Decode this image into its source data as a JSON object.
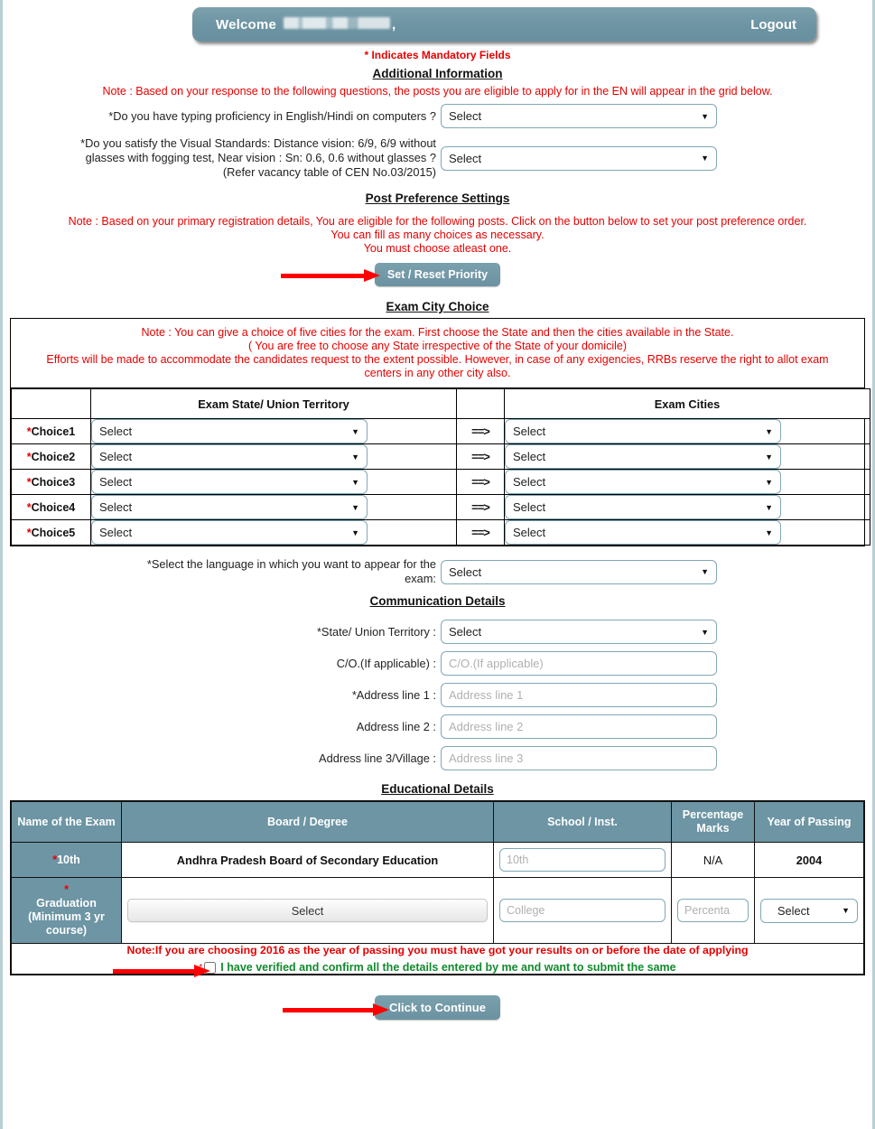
{
  "header": {
    "welcome_label": "Welcome",
    "user_name_redacted": "",
    "comma": ",",
    "logout_label": "Logout"
  },
  "mandatory_note": "*  Indicates Mandatory Fields",
  "additional_information": {
    "title": "Additional Information",
    "note": "Note : Based on your response to the following questions, the posts you are eligible to apply for in the EN will appear in the grid below.",
    "typing_label": "*Do you have typing proficiency in English/Hindi on computers ?",
    "typing_value": "Select",
    "vision_label_line1": "*Do you satisfy the Visual Standards: Distance vision: 6/9, 6/9 without",
    "vision_label_line2": "glasses with fogging test, Near vision : Sn: 0.6, 0.6 without glasses ?",
    "vision_label_line3": "(Refer vacancy table of CEN No.03/2015)",
    "vision_value": "Select"
  },
  "post_preference": {
    "title": "Post Preference Settings",
    "note_line1": "Note : Based on your primary registration details, You are eligible for the following posts. Click on the button below to set your post preference order.",
    "note_line2": "You can fill as many choices as necessary.",
    "note_line3": "You must choose atleast one.",
    "button_label": "Set / Reset Priority"
  },
  "exam_city": {
    "title": "Exam City Choice",
    "note_line1": "Note : You can give a choice of five cities for the exam. First choose the State and then the cities available in the State.",
    "note_line2": "( You are free to choose any State irrespective of the State of your domicile)",
    "note_line3": "Efforts will be made to accommodate the candidates request to the extent possible. However, in case of any exigencies, RRBs reserve the right to allot exam",
    "note_line4": "centers in any other city also.",
    "col_state": "Exam State/ Union Territory",
    "col_cities": "Exam Cities",
    "arrow_glyph": "==>",
    "rows": [
      {
        "label": "*Choice1",
        "state": "Select",
        "city": "Select"
      },
      {
        "label": "*Choice2",
        "state": "Select",
        "city": "Select"
      },
      {
        "label": "*Choice3",
        "state": "Select",
        "city": "Select"
      },
      {
        "label": "*Choice4",
        "state": "Select",
        "city": "Select"
      },
      {
        "label": "*Choice5",
        "state": "Select",
        "city": "Select"
      }
    ]
  },
  "language": {
    "label_line1": "*Select the language in which you want to appear for the",
    "label_line2": "exam:",
    "value": "Select"
  },
  "communication": {
    "title": "Communication Details",
    "state_label": "*State/ Union Territory :",
    "state_value": "Select",
    "co_label": "C/O.(If applicable) :",
    "co_placeholder": "C/O.(If applicable)",
    "co_value": "",
    "addr1_label": "*Address line 1 :",
    "addr1_placeholder": "Address line 1",
    "addr1_value": "",
    "addr2_label": "Address line 2 :",
    "addr2_placeholder": "Address line 2",
    "addr2_value": "",
    "addr3_label": "Address line 3/Village :",
    "addr3_placeholder": "Address line 3",
    "addr3_value": ""
  },
  "education": {
    "title": "Educational Details",
    "columns": {
      "exam_name": "Name of the Exam",
      "board_degree": "Board / Degree",
      "school": "School / Inst.",
      "percentage": "Percentage Marks",
      "year": "Year of Passing"
    },
    "rows": [
      {
        "exam_name": "10th",
        "exam_name_required": true,
        "board_degree": "Andhra Pradesh Board of Secondary Education",
        "board_is_select": false,
        "school_placeholder": "10th",
        "school_value": "",
        "percentage": "N/A",
        "percentage_is_input": false,
        "year": "2004",
        "year_is_select": false
      },
      {
        "exam_name": "Graduation (Minimum 3 yr course)",
        "exam_name_required": true,
        "board_degree": "Select",
        "board_is_select": true,
        "school_placeholder": "College",
        "school_value": "",
        "percentage": "Percenta",
        "percentage_is_input": true,
        "year": "Select",
        "year_is_select": true
      }
    ],
    "footer_note": "Note:If you are choosing 2016 as the year of passing you must have got your results on or before the date of applying",
    "confirm_text": "I have verified and confirm all the details entered by me and want to submit the same",
    "confirm_checked": false
  },
  "submit": {
    "button_label": "Click to Continue"
  },
  "colors": {
    "teal": "#6d95a4",
    "teal_light": "#7ba0ad",
    "red": "#e60000",
    "green": "#128a2e",
    "border_blue": "#7fa8b5",
    "arrow_red": "#ff0000"
  }
}
